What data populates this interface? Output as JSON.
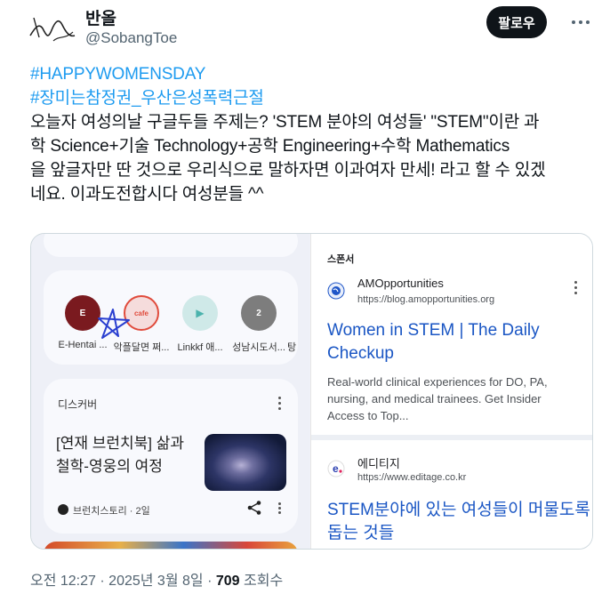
{
  "author": {
    "name": "반올",
    "handle": "@SobangToe",
    "follow_label": "팔로우"
  },
  "tweet": {
    "hashtag_1": "#HAPPYWOMENSDAY",
    "hashtag_2": "#장미는참정권_우산은성폭력근절",
    "line_1": "오늘자 여성의날 구글두들 주제는? 'STEM 분야의 여성들' \"STEM\"이란 과",
    "line_2": "학 Science+기술 Technology+공학 Engineering+수학 Mathematics",
    "line_3": "을 앞글자만 딴 것으로 우리식으로 말하자면 이과여자 만세! 라고 할 수 있겠",
    "line_4": "네요. 이과도전합시다 여성분들 ^^"
  },
  "left_screenshot": {
    "shortcuts": [
      {
        "label": "E-Hentai ...",
        "glyph": "E",
        "color": "#7a1a1f"
      },
      {
        "label": "악플달면 쩌...",
        "glyph": "cafe",
        "color": "#e04b3c"
      },
      {
        "label": "Linkkf 애...",
        "glyph": "▶",
        "color": "#8fd3cf"
      },
      {
        "label": "성남시도서...",
        "glyph": "2",
        "color": "#7d7d7d"
      },
      {
        "label": "탕",
        "glyph": "",
        "color": "#dddddd"
      }
    ],
    "discover_title": "디스커버",
    "headline": "[연재 브런치북] 삶과 철학-영웅의 여정",
    "source": "브런치스토리 · 2일"
  },
  "right_screenshot": {
    "sponsor_label": "스폰서",
    "ads": [
      {
        "name": "AMOpportunities",
        "url": "https://blog.amopportunities.org",
        "title_1": "Women in STEM | The Daily",
        "title_2": "Checkup",
        "desc_1": "Real-world clinical experiences for DO, PA,",
        "desc_2": "nursing, and medical trainees. Get Insider",
        "desc_3": "Access to Top..."
      },
      {
        "name": "에디티지",
        "url": "https://www.editage.co.kr",
        "title_1": "STEM분야에 있는 여성들이 머물도록",
        "title_2": "돕는 것들"
      }
    ]
  },
  "footer": {
    "time": "오전 12:27",
    "date": "2025년 3월 8일",
    "views_count": "709",
    "views_label": "조회수"
  },
  "colors": {
    "hashtag": "#1d9bf0",
    "ad_title": "#1a56c4",
    "follow_button": "#0f1419"
  }
}
